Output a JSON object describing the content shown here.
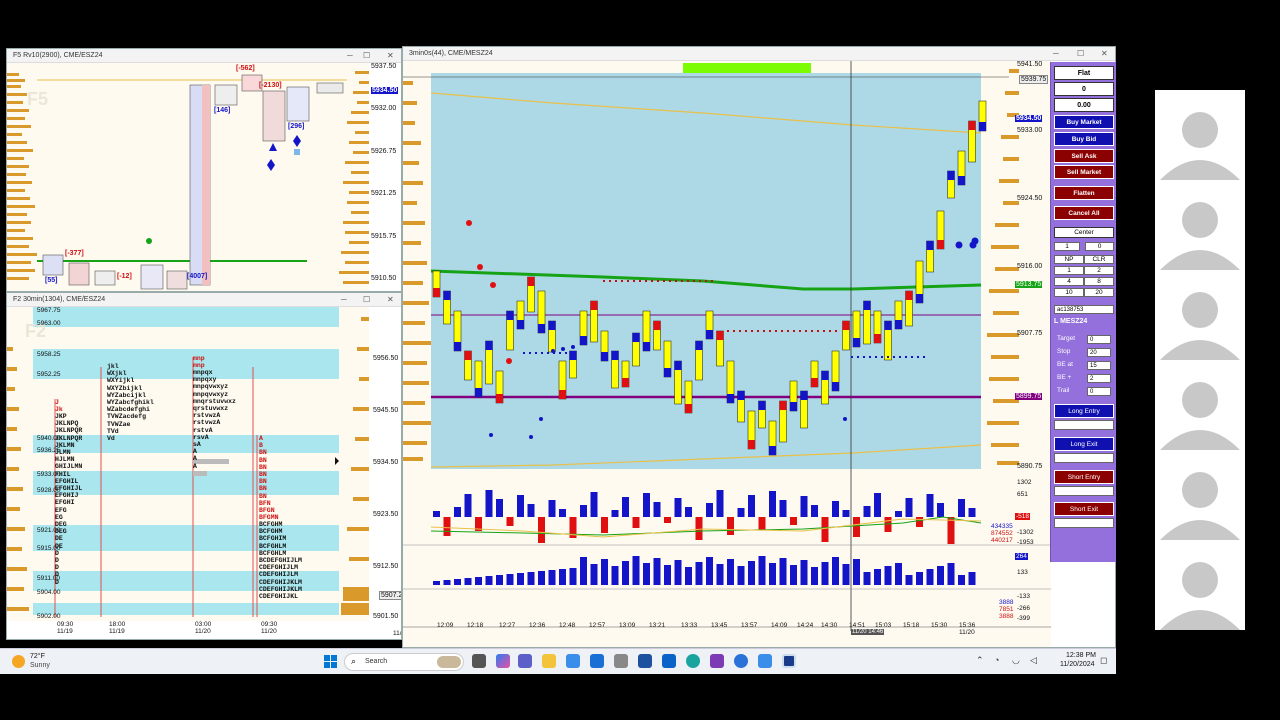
{
  "left_top_window": {
    "title": "F5 Rv10(2900), CME/ESZ24",
    "watermark": "F5",
    "price_labels": [
      "5937.50",
      "5932.00",
      "5926.75",
      "5921.25",
      "5915.75",
      "5910.50"
    ],
    "last_price": "5934.50",
    "deltas_red": [
      "[-562]",
      "[-2130]",
      "[-377]",
      "[-12]"
    ],
    "deltas_blue": [
      "[146]",
      "[296]",
      "[55]",
      "[4007]"
    ]
  },
  "left_bottom_window": {
    "title": "F2 30min(1304), CME/ESZ24",
    "watermark": "F2",
    "level_labels": [
      "5967.75",
      "5963.00",
      "5958.25",
      "5952.25",
      "5940.00",
      "5936.25",
      "5933.00",
      "5928.00",
      "5921.00",
      "5915.00",
      "5911.00",
      "5904.00",
      "5902.00"
    ],
    "right_axis": [
      "5956.50",
      "5945.50",
      "5934.50",
      "5923.50",
      "5912.50",
      "5901.50"
    ],
    "right_axis_box": "5907.25",
    "time_labels": [
      {
        "time": "09:30",
        "date": "11/19"
      },
      {
        "time": "18:00",
        "date": "11/19"
      },
      {
        "time": "03:00",
        "date": "11/20"
      },
      {
        "time": "09:30",
        "date": "11/20"
      }
    ],
    "cut_label": "11/"
  },
  "main_chart": {
    "title": "3min0s(44), CME/MESZ24",
    "price_axis": [
      "5941.50",
      "5933.00",
      "5924.50",
      "5916.00",
      "5907.75",
      "5899.75",
      "5890.75"
    ],
    "last_price": "5934.50",
    "top_price_box": "5939.75",
    "green_box": "5913.75",
    "purple_box": "5899.75",
    "delta_axis": [
      "1302",
      "651",
      "-1302",
      "-1953"
    ],
    "delta_values": [
      "-518",
      "434335",
      "874552",
      "440217"
    ],
    "volume_axis": [
      "264",
      "133",
      "-133",
      "-266",
      "-399"
    ],
    "volume_values": [
      "3888",
      "7851",
      "3888"
    ],
    "times": [
      "12:09",
      "12:18",
      "12:27",
      "12:36",
      "12:48",
      "12:57",
      "13:09",
      "13:21",
      "13:33",
      "13:45",
      "13:57",
      "14:09",
      "14:24",
      "14:30",
      "14:51",
      "15:03",
      "15:18",
      "15:30",
      "15:36"
    ],
    "end_date": "11/20",
    "cursor_label": "11/20 14:46"
  },
  "order_panel": {
    "position": "Flat",
    "qty": "0",
    "pnl": "0.00",
    "buy_market": "Buy Market",
    "buy_bid": "Buy Bid",
    "sell_ask": "Sell Ask",
    "sell_market": "Sell Market",
    "flatten": "Flatten",
    "cancel_all": "Cancel All",
    "center": "Center",
    "qty_input": "1",
    "qty_right": "0",
    "grid": [
      [
        "NP",
        "CLR"
      ],
      [
        "1",
        "2"
      ],
      [
        "4",
        "8"
      ],
      [
        "10",
        "20"
      ]
    ],
    "account": "ac138753",
    "symbol_label": "L MESZ24",
    "target_label": "Target",
    "target_val": "0",
    "stop_label": "Stop",
    "stop_val": "20",
    "beat_label": "BE at",
    "beat_val": "15",
    "beplus_label": "BE +",
    "beplus_val": "2",
    "trail_label": "Trail",
    "trail_val": "0",
    "long_entry": "Long Entry",
    "long_exit": "Long Exit",
    "short_entry": "Short Entry",
    "short_exit": "Short Exit",
    "colors": {
      "blue": "#1010b0",
      "red": "#8b0000",
      "purple": "#9370db"
    }
  },
  "taskbar": {
    "weather_temp": "72°F",
    "weather_desc": "Sunny",
    "search": "Search",
    "time": "12:38 PM",
    "date": "11/20/2024",
    "icons": [
      "windows-icon",
      "task-view-icon",
      "copilot-icon",
      "teams-icon",
      "file-explorer-icon",
      "store-icon",
      "mail-icon",
      "settings-icon",
      "media-icon",
      "outlook-icon",
      "edge-icon",
      "visual-studio-icon",
      "vpn-icon",
      "snipping-icon",
      "active-app-icon"
    ]
  }
}
